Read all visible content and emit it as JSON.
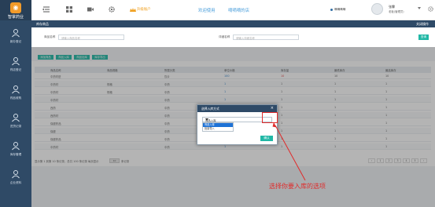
{
  "sidebar": {
    "logo_text": "智掌药业",
    "items": [
      {
        "label": "新办登记",
        "icon": "user-icon"
      },
      {
        "label": "药店登记",
        "icon": "user-icon"
      },
      {
        "label": "药品收购",
        "icon": "user-icon"
      },
      {
        "label": "进货记录",
        "icon": "user-icon"
      },
      {
        "label": "库存管理",
        "icon": "user-icon"
      },
      {
        "label": "企业资料",
        "icon": "user-icon"
      }
    ]
  },
  "header": {
    "upgrade": "升级账户",
    "welcome": "欢迎使用",
    "shop_name": "嘀嘀嘀的店",
    "status": "嘀嘀嘀嘀",
    "user_name": "张霖",
    "user_role": "老板(管理员)"
  },
  "titlebar": {
    "tab": "库存商品",
    "close_all": "关闭操作"
  },
  "search": {
    "name_label": "商品名称",
    "name_placeholder": "请输入商品名称",
    "code_label": "详细名称",
    "code_placeholder": "请输入详细名称",
    "query_label": "查询"
  },
  "actions": [
    "添加商品",
    "商品入库",
    "商品出库",
    "库存导出"
  ],
  "table": {
    "headers": [
      "商品名称",
      "商品规格",
      "所属分类",
      "单位价格",
      "库存量",
      "最低库存",
      "最高库存"
    ],
    "rows": [
      [
        "中药材进",
        "",
        "饮片",
        "100",
        "10",
        "10",
        "10"
      ],
      [
        "中药材",
        "规格",
        "中药",
        "1",
        "1",
        "1",
        "1"
      ],
      [
        "中药材",
        "规格",
        "中药",
        "1",
        "1",
        "1",
        "1"
      ],
      [
        "中药材",
        "",
        "中药",
        "1",
        "1",
        "1",
        "1"
      ],
      [
        "西药",
        "",
        "中药",
        "1",
        "1",
        "1",
        "1"
      ],
      [
        "西药材",
        "",
        "中药",
        "1",
        "1",
        "1",
        "1"
      ],
      [
        "保健药品",
        "",
        "中药",
        "1",
        "1",
        "1",
        "1"
      ],
      [
        "保健",
        "",
        "中药",
        "1",
        "1",
        "1",
        "1"
      ],
      [
        "保健药品",
        "",
        "中药",
        "1",
        "1",
        "1",
        "1"
      ],
      [
        "中药材",
        "",
        "中药",
        "1",
        "1",
        "1",
        "1"
      ]
    ]
  },
  "footer": {
    "info": "显示第 1 到第 10 条记录，总共 100 条记录 每页显示",
    "per_page": "10",
    "info_tail": "条记录",
    "pages": [
      "‹",
      "1",
      "2",
      "3",
      "4",
      "5",
      "›"
    ]
  },
  "dialog": {
    "title": "选择入库方式",
    "close": "×",
    "selected": "商品入库",
    "options": [
      "商品入库",
      "批量导入"
    ],
    "confirm": "确认"
  },
  "annotation": "选择你要入库的选项",
  "colors": {
    "sidebar": "#2f4a66",
    "accent": "#21b8a6",
    "annotation": "#e02b2b"
  }
}
